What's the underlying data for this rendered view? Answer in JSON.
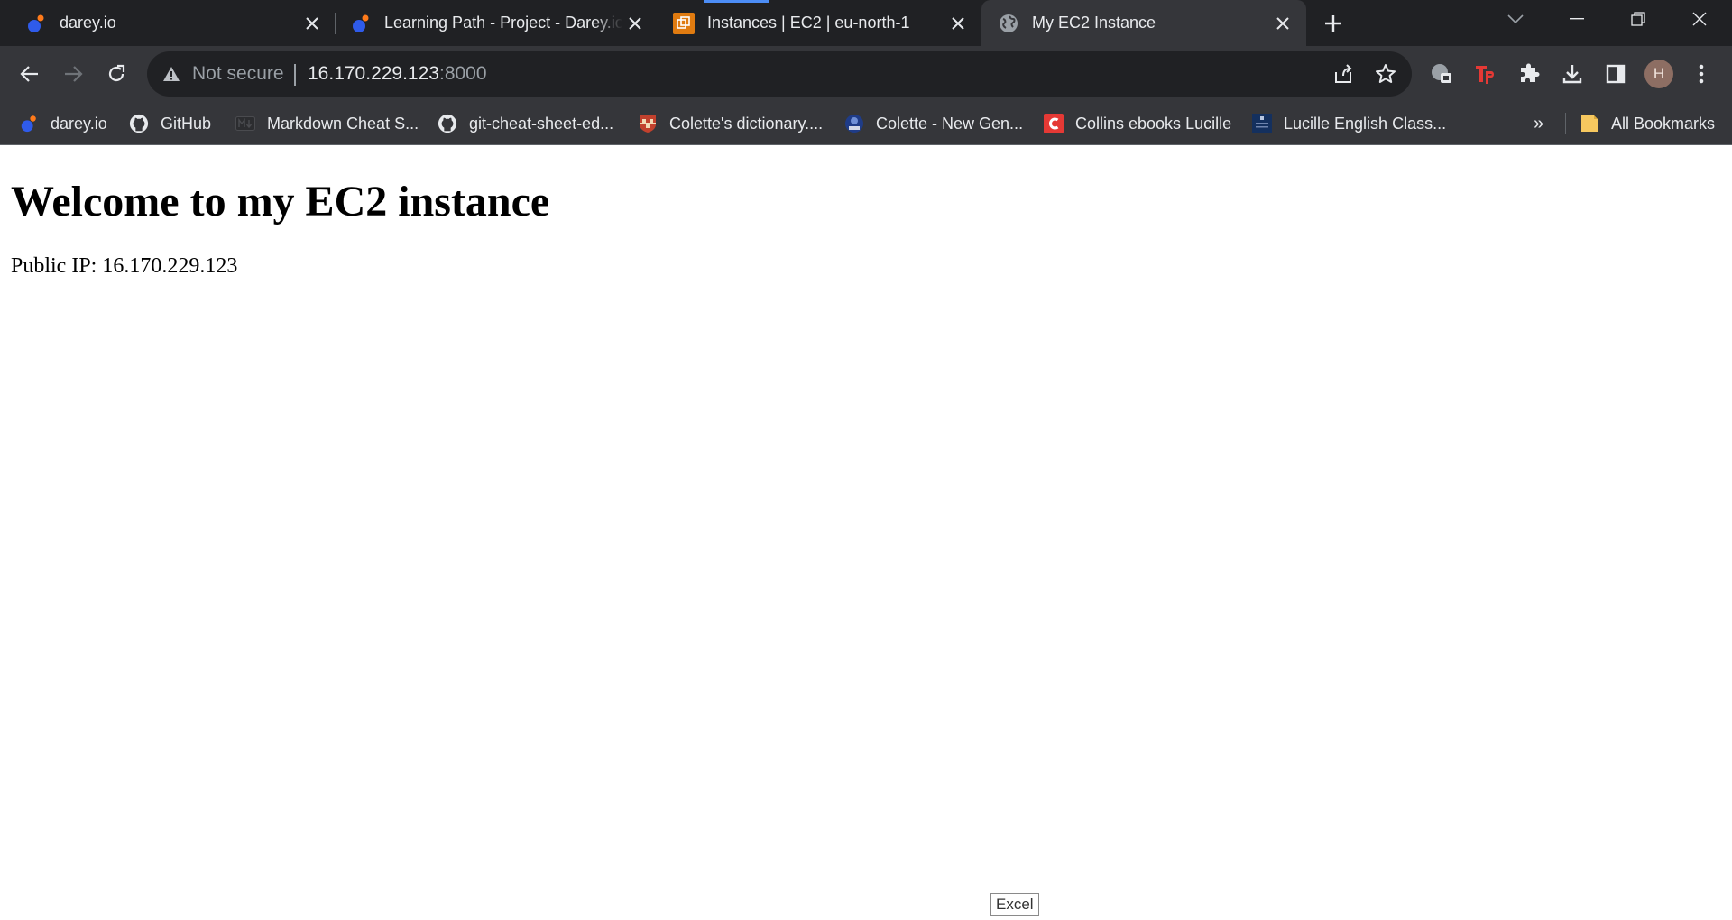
{
  "tabs": [
    {
      "title": "darey.io",
      "favicon": "darey-icon",
      "active": false
    },
    {
      "title": "Learning Path - Project - Darey.io",
      "favicon": "darey-icon",
      "active": false
    },
    {
      "title": "Instances | EC2 | eu-north-1",
      "favicon": "aws-ec2-icon",
      "active": false
    },
    {
      "title": "My EC2 Instance",
      "favicon": "globe-icon",
      "active": true
    }
  ],
  "toolbar": {
    "security_label": "Not secure",
    "url_host": "16.170.229.123",
    "url_port": ":8000",
    "avatar_initial": "H"
  },
  "bookmarks": [
    {
      "label": "darey.io",
      "icon": "darey-icon"
    },
    {
      "label": "GitHub",
      "icon": "github-icon"
    },
    {
      "label": "Markdown Cheat S...",
      "icon": "markdown-icon"
    },
    {
      "label": "git-cheat-sheet-ed...",
      "icon": "github-icon"
    },
    {
      "label": "Colette's dictionary....",
      "icon": "cambridge-icon"
    },
    {
      "label": "Colette - New Gen...",
      "icon": "badge-icon"
    },
    {
      "label": "Collins ebooks Lucille",
      "icon": "collins-icon"
    },
    {
      "label": "Lucille English Class...",
      "icon": "class-icon"
    }
  ],
  "bookmarks_overflow": "»",
  "all_bookmarks": "All Bookmarks",
  "page": {
    "heading": "Welcome to my EC2 instance",
    "ip_text": "Public IP: 16.170.229.123"
  },
  "excel_badge": "Excel",
  "colors": {
    "tab_strip": "#202124",
    "toolbar": "#35363a",
    "omnibox": "#202124",
    "loading_accent": "#4c8df6",
    "tp_red": "#e53935"
  }
}
